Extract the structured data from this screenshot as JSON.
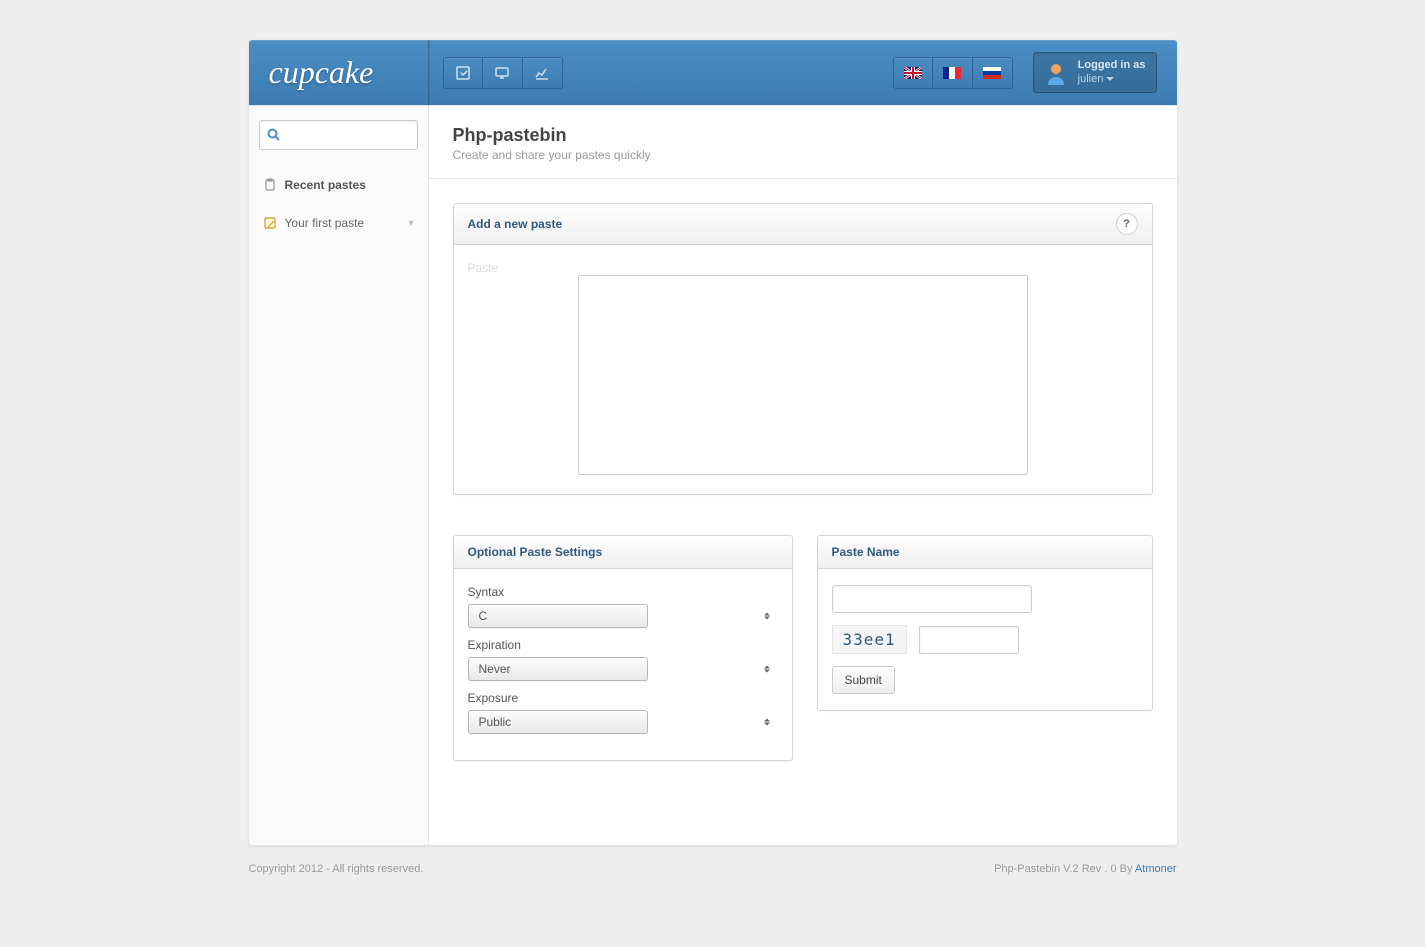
{
  "header": {
    "logo": "cupcake",
    "user": {
      "label": "Logged in as",
      "name": "julien"
    }
  },
  "sidebar": {
    "recent_heading": "Recent pastes",
    "items": [
      {
        "label": "Your first paste"
      }
    ]
  },
  "page": {
    "title": "Php-pastebin",
    "subtitle": "Create and share your pastes quickly"
  },
  "panels": {
    "new_paste": {
      "title": "Add a new paste",
      "help": "?",
      "paste_label": "Paste"
    },
    "settings": {
      "title": "Optional Paste Settings",
      "syntax_label": "Syntax",
      "syntax_value": "C",
      "expiration_label": "Expiration",
      "expiration_value": "Never",
      "exposure_label": "Exposure",
      "exposure_value": "Public"
    },
    "name": {
      "title": "Paste Name",
      "captcha": "33ee1",
      "submit": "Submit"
    }
  },
  "footer": {
    "left": "Copyright 2012 - All rights reserved.",
    "right_prefix": "Php-Pastebin V.2 Rev . 0 By ",
    "right_link": "Atmoner"
  }
}
